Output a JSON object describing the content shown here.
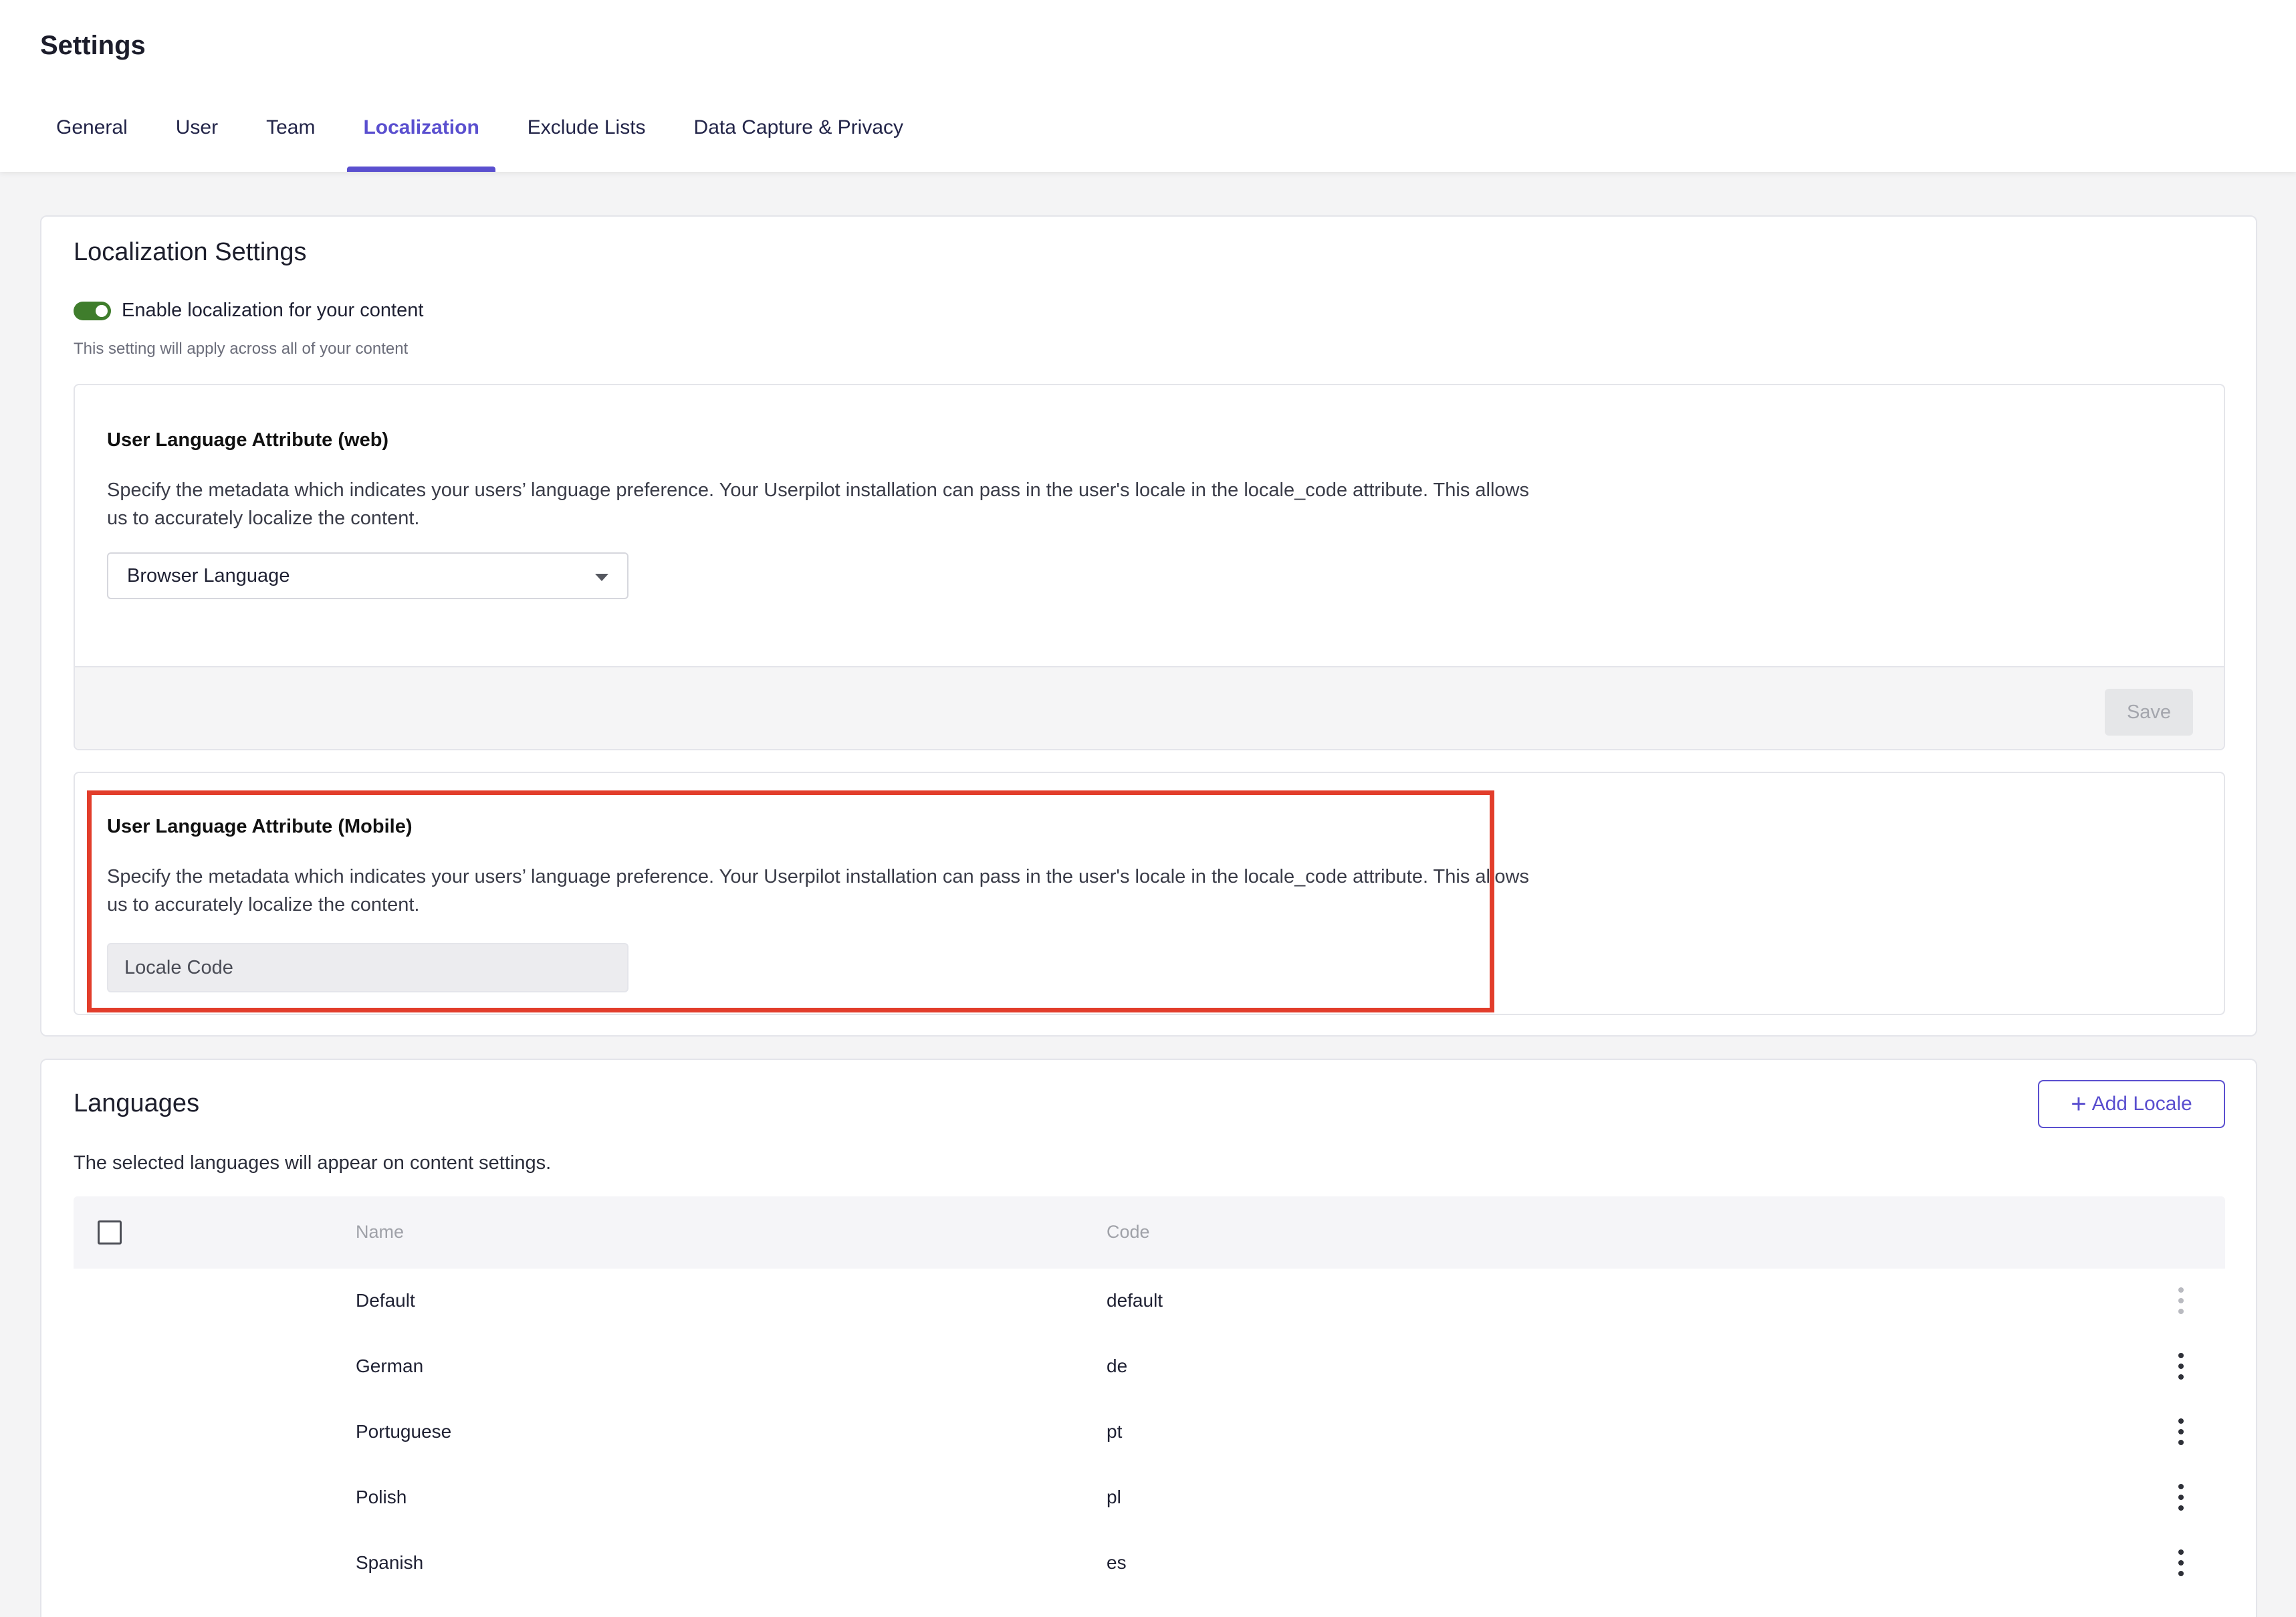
{
  "page": {
    "title": "Settings"
  },
  "tabs": [
    {
      "label": "General",
      "active": false
    },
    {
      "label": "User",
      "active": false
    },
    {
      "label": "Team",
      "active": false
    },
    {
      "label": "Localization",
      "active": true
    },
    {
      "label": "Exclude Lists",
      "active": false
    },
    {
      "label": "Data Capture & Privacy",
      "active": false
    }
  ],
  "localization": {
    "title": "Localization Settings",
    "toggle_label": "Enable localization for your content",
    "toggle_on": true,
    "toggle_hint": "This setting will apply across all of your content",
    "web": {
      "title": "User Language Attribute (web)",
      "description": "Specify the metadata which indicates your users’ language preference. Your Userpilot installation can pass in the user's locale in the locale_code attribute. This allows us to accurately localize the content.",
      "select_value": "Browser Language",
      "save_label": "Save"
    },
    "mobile": {
      "title": "User Language Attribute (Mobile)",
      "description": "Specify the metadata which indicates your users’ language preference. Your Userpilot installation can pass in the user's locale in the locale_code attribute. This allows us to accurately localize the content.",
      "input_value": "Locale Code"
    }
  },
  "languages": {
    "title": "Languages",
    "add_label": "Add Locale",
    "description": "The selected languages will appear on content settings.",
    "columns": {
      "name": "Name",
      "code": "Code"
    },
    "rows": [
      {
        "name": "Default",
        "code": "default",
        "menu_disabled": true
      },
      {
        "name": "German",
        "code": "de",
        "menu_disabled": false
      },
      {
        "name": "Portuguese",
        "code": "pt",
        "menu_disabled": false
      },
      {
        "name": "Polish",
        "code": "pl",
        "menu_disabled": false
      },
      {
        "name": "Spanish",
        "code": "es",
        "menu_disabled": false
      }
    ]
  },
  "colors": {
    "accent": "#5a4fcf",
    "toggle_on": "#3f7d2c",
    "highlight": "#e23d2b"
  }
}
